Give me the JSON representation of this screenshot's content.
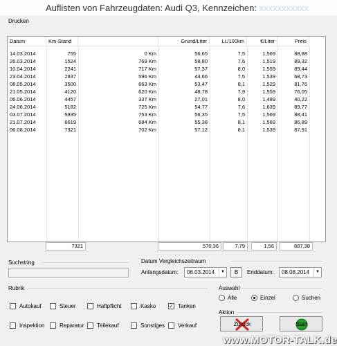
{
  "window": {
    "title": "Auflisten von Fahrzeugdaten: Audi Q3, Kennzeichen:",
    "title_rest": "xxxxxxxxxxx"
  },
  "menu": {
    "print": "Drucken"
  },
  "table": {
    "headers": [
      "Datum",
      "Km-Stand",
      "",
      "Grund/Liter",
      "Li./100km",
      "€/Liter",
      "Preis"
    ],
    "rows": [
      [
        "14.03.2014",
        "755",
        "0 Km",
        "56,65",
        "7,5",
        "1,569",
        "88,88"
      ],
      [
        "26.03.2014",
        "1524",
        "769 Km",
        "58,80",
        "7,6",
        "1,519",
        "89,32"
      ],
      [
        "10.04.2014",
        "2241",
        "717 Km",
        "57,37",
        "8,0",
        "1,559",
        "89,44"
      ],
      [
        "23.04.2014",
        "2837",
        "596 Km",
        "44,66",
        "7,5",
        "1,539",
        "68,73"
      ],
      [
        "08.05.2014",
        "3500",
        "663 Km",
        "53,47",
        "8,1",
        "1,529",
        "81,76"
      ],
      [
        "21.05.2014",
        "4120",
        "620 Km",
        "48,78",
        "7,9",
        "1,559",
        "76,05"
      ],
      [
        "06.06.2014",
        "4457",
        "337 Km",
        "27,01",
        "8,0",
        "1,489",
        "40,22"
      ],
      [
        "24.06.2014",
        "5182",
        "725 Km",
        "54,77",
        "7,6",
        "1,639",
        "89,77"
      ],
      [
        "03.07.2014",
        "5935",
        "753 Km",
        "56,35",
        "7,5",
        "1,569",
        "88,41"
      ],
      [
        "21.07.2014",
        "6619",
        "684 Km",
        "55,38",
        "8,1",
        "1,569",
        "86,89"
      ],
      [
        "06.08.2014",
        "7321",
        "702 Km",
        "57,12",
        "8,1",
        "1,539",
        "87,91"
      ]
    ],
    "totals": {
      "km": "7321",
      "grund": "570,36",
      "li100": "7,79",
      "eur_liter": "1,56",
      "preis": "887,38"
    }
  },
  "search": {
    "label": "Suchstring",
    "value": ""
  },
  "compare": {
    "label": "Datum Vergleichszeitraum",
    "start_label": "Anfangsdatum:",
    "start_value": "06.03.2014",
    "b_button": "B",
    "end_label": "Enddatum:",
    "end_value": "08.08.2014"
  },
  "rubrik": {
    "label": "Rubrik",
    "items": [
      {
        "label": "Autokauf",
        "checked": false
      },
      {
        "label": "Steuer",
        "checked": false
      },
      {
        "label": "Haftpflicht",
        "checked": false
      },
      {
        "label": "Kasko",
        "checked": false
      },
      {
        "label": "Tanken",
        "checked": true
      },
      {
        "label": "Inspektion",
        "checked": false
      },
      {
        "label": "Reparatur",
        "checked": false
      },
      {
        "label": "Teilekauf",
        "checked": false
      },
      {
        "label": "Sonstiges",
        "checked": false
      },
      {
        "label": "Verkauf",
        "checked": false
      }
    ]
  },
  "auswahl": {
    "label": "Auswahl",
    "options": [
      {
        "label": "Alle",
        "selected": false
      },
      {
        "label": "Einzel",
        "selected": true
      },
      {
        "label": "Suchen",
        "selected": false
      }
    ]
  },
  "aktion": {
    "label": "Aktion",
    "back_label": "Zurück",
    "start_label": "Start"
  },
  "watermark": "www.MOTOR-TALK.de",
  "colors": {
    "accent_red": "#d22020",
    "accent_green": "#2a9a2a"
  }
}
